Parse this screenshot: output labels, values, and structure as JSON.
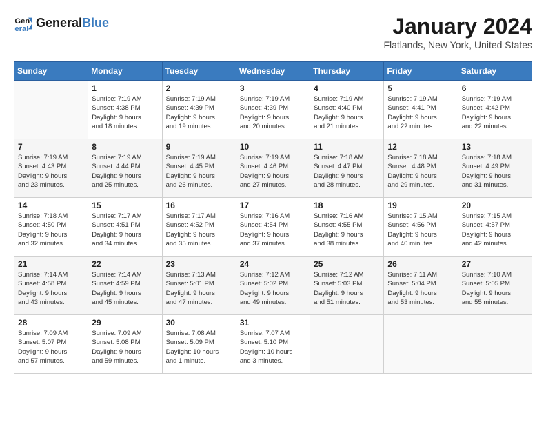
{
  "header": {
    "logo_line1": "General",
    "logo_line2": "Blue",
    "month_title": "January 2024",
    "location": "Flatlands, New York, United States"
  },
  "weekdays": [
    "Sunday",
    "Monday",
    "Tuesday",
    "Wednesday",
    "Thursday",
    "Friday",
    "Saturday"
  ],
  "weeks": [
    [
      {
        "day": "",
        "info": ""
      },
      {
        "day": "1",
        "info": "Sunrise: 7:19 AM\nSunset: 4:38 PM\nDaylight: 9 hours\nand 18 minutes."
      },
      {
        "day": "2",
        "info": "Sunrise: 7:19 AM\nSunset: 4:39 PM\nDaylight: 9 hours\nand 19 minutes."
      },
      {
        "day": "3",
        "info": "Sunrise: 7:19 AM\nSunset: 4:39 PM\nDaylight: 9 hours\nand 20 minutes."
      },
      {
        "day": "4",
        "info": "Sunrise: 7:19 AM\nSunset: 4:40 PM\nDaylight: 9 hours\nand 21 minutes."
      },
      {
        "day": "5",
        "info": "Sunrise: 7:19 AM\nSunset: 4:41 PM\nDaylight: 9 hours\nand 22 minutes."
      },
      {
        "day": "6",
        "info": "Sunrise: 7:19 AM\nSunset: 4:42 PM\nDaylight: 9 hours\nand 22 minutes."
      }
    ],
    [
      {
        "day": "7",
        "info": "Sunrise: 7:19 AM\nSunset: 4:43 PM\nDaylight: 9 hours\nand 23 minutes."
      },
      {
        "day": "8",
        "info": "Sunrise: 7:19 AM\nSunset: 4:44 PM\nDaylight: 9 hours\nand 25 minutes."
      },
      {
        "day": "9",
        "info": "Sunrise: 7:19 AM\nSunset: 4:45 PM\nDaylight: 9 hours\nand 26 minutes."
      },
      {
        "day": "10",
        "info": "Sunrise: 7:19 AM\nSunset: 4:46 PM\nDaylight: 9 hours\nand 27 minutes."
      },
      {
        "day": "11",
        "info": "Sunrise: 7:18 AM\nSunset: 4:47 PM\nDaylight: 9 hours\nand 28 minutes."
      },
      {
        "day": "12",
        "info": "Sunrise: 7:18 AM\nSunset: 4:48 PM\nDaylight: 9 hours\nand 29 minutes."
      },
      {
        "day": "13",
        "info": "Sunrise: 7:18 AM\nSunset: 4:49 PM\nDaylight: 9 hours\nand 31 minutes."
      }
    ],
    [
      {
        "day": "14",
        "info": "Sunrise: 7:18 AM\nSunset: 4:50 PM\nDaylight: 9 hours\nand 32 minutes."
      },
      {
        "day": "15",
        "info": "Sunrise: 7:17 AM\nSunset: 4:51 PM\nDaylight: 9 hours\nand 34 minutes."
      },
      {
        "day": "16",
        "info": "Sunrise: 7:17 AM\nSunset: 4:52 PM\nDaylight: 9 hours\nand 35 minutes."
      },
      {
        "day": "17",
        "info": "Sunrise: 7:16 AM\nSunset: 4:54 PM\nDaylight: 9 hours\nand 37 minutes."
      },
      {
        "day": "18",
        "info": "Sunrise: 7:16 AM\nSunset: 4:55 PM\nDaylight: 9 hours\nand 38 minutes."
      },
      {
        "day": "19",
        "info": "Sunrise: 7:15 AM\nSunset: 4:56 PM\nDaylight: 9 hours\nand 40 minutes."
      },
      {
        "day": "20",
        "info": "Sunrise: 7:15 AM\nSunset: 4:57 PM\nDaylight: 9 hours\nand 42 minutes."
      }
    ],
    [
      {
        "day": "21",
        "info": "Sunrise: 7:14 AM\nSunset: 4:58 PM\nDaylight: 9 hours\nand 43 minutes."
      },
      {
        "day": "22",
        "info": "Sunrise: 7:14 AM\nSunset: 4:59 PM\nDaylight: 9 hours\nand 45 minutes."
      },
      {
        "day": "23",
        "info": "Sunrise: 7:13 AM\nSunset: 5:01 PM\nDaylight: 9 hours\nand 47 minutes."
      },
      {
        "day": "24",
        "info": "Sunrise: 7:12 AM\nSunset: 5:02 PM\nDaylight: 9 hours\nand 49 minutes."
      },
      {
        "day": "25",
        "info": "Sunrise: 7:12 AM\nSunset: 5:03 PM\nDaylight: 9 hours\nand 51 minutes."
      },
      {
        "day": "26",
        "info": "Sunrise: 7:11 AM\nSunset: 5:04 PM\nDaylight: 9 hours\nand 53 minutes."
      },
      {
        "day": "27",
        "info": "Sunrise: 7:10 AM\nSunset: 5:05 PM\nDaylight: 9 hours\nand 55 minutes."
      }
    ],
    [
      {
        "day": "28",
        "info": "Sunrise: 7:09 AM\nSunset: 5:07 PM\nDaylight: 9 hours\nand 57 minutes."
      },
      {
        "day": "29",
        "info": "Sunrise: 7:09 AM\nSunset: 5:08 PM\nDaylight: 9 hours\nand 59 minutes."
      },
      {
        "day": "30",
        "info": "Sunrise: 7:08 AM\nSunset: 5:09 PM\nDaylight: 10 hours\nand 1 minute."
      },
      {
        "day": "31",
        "info": "Sunrise: 7:07 AM\nSunset: 5:10 PM\nDaylight: 10 hours\nand 3 minutes."
      },
      {
        "day": "",
        "info": ""
      },
      {
        "day": "",
        "info": ""
      },
      {
        "day": "",
        "info": ""
      }
    ]
  ]
}
